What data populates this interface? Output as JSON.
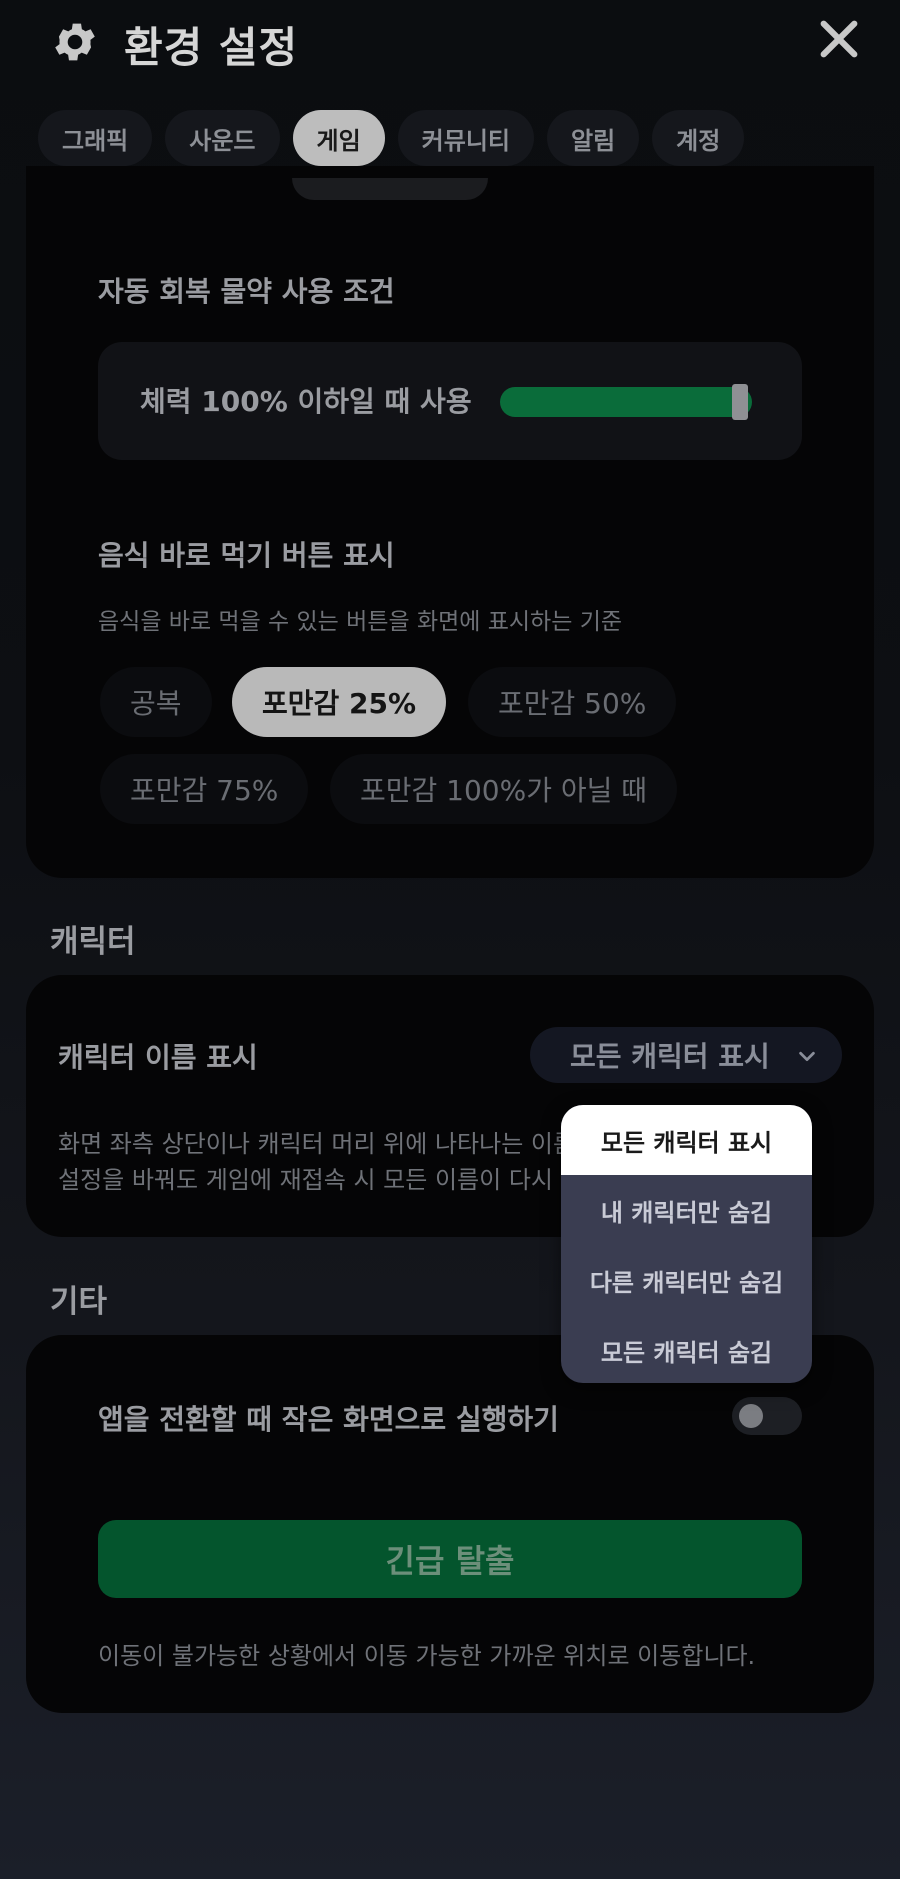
{
  "header": {
    "title": "환경 설정",
    "icon": "gear-icon",
    "close_icon": "close-icon"
  },
  "tabs": [
    {
      "label": "그래픽"
    },
    {
      "label": "사운드"
    },
    {
      "label": "게임",
      "active": true
    },
    {
      "label": "커뮤니티"
    },
    {
      "label": "알림"
    },
    {
      "label": "계정"
    }
  ],
  "potion": {
    "title": "자동 회복 물약 사용 조건",
    "slider_label": "체력 100% 이하일 때 사용",
    "slider_value_percent": 100
  },
  "food": {
    "title": "음식 바로 먹기 버튼 표시",
    "description": "음식을 바로 먹을 수 있는 버튼을 화면에 표시하는 기준",
    "options": [
      "공복",
      "포만감 25%",
      "포만감 50%",
      "포만감 75%",
      "포만감 100%가 아닐 때"
    ],
    "selected": "포만감 25%"
  },
  "character": {
    "section": "캐릭터",
    "name_label": "캐릭터 이름 표시",
    "dropdown_value": "모든 캐릭터 표시",
    "description_line1": "화면 좌측 상단이나 캐릭터 머리 위에 나타나는 이름",
    "description_line2": "설정을 바꿔도 게임에 재접속 시 모든 이름이 다시 표",
    "menu_options": [
      "모든 캐릭터 표시",
      "내 캐릭터만 숨김",
      "다른 캐릭터만 숨김",
      "모든 캐릭터 숨김"
    ]
  },
  "other": {
    "section": "기타",
    "pip_label": "앱을 전환할 때 작은 화면으로 실행하기",
    "pip_enabled": false,
    "escape_button": "긴급 탈출",
    "escape_description": "이동이 불가능한 상황에서 이동 가능한 가까운 위치로 이동합니다."
  },
  "colors": {
    "accent_green": "#0a6c3a",
    "escape_green": "#04552d",
    "menu_bg": "#3a3d51"
  }
}
